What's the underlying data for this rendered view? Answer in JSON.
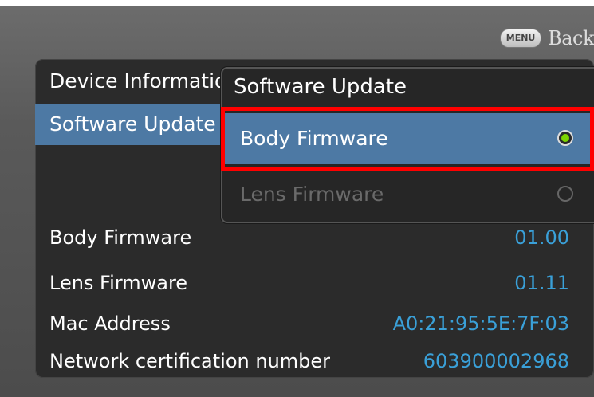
{
  "header": {
    "menu_button_label": "MENU",
    "back_label": "Back"
  },
  "sidebar": {
    "items": [
      {
        "label": "Device Information"
      },
      {
        "label": "Software Update"
      }
    ]
  },
  "popup": {
    "title": "Software Update",
    "options": [
      {
        "label": "Body Firmware",
        "selected": true,
        "enabled": true
      },
      {
        "label": "Lens Firmware",
        "selected": false,
        "enabled": false
      }
    ]
  },
  "info": {
    "rows": [
      {
        "label": "Body Firmware",
        "value": "01.00"
      },
      {
        "label": "Lens Firmware",
        "value": "01.11"
      },
      {
        "label": "Mac Address",
        "value": "A0:21:95:5E:7F:03"
      },
      {
        "label": "Network certification number",
        "value": "603900002968"
      }
    ]
  },
  "colors": {
    "selection_blue": "#4d79a4",
    "value_blue": "#3aa0d8",
    "radio_on": "#7cd400",
    "highlight_red": "#ff0000"
  }
}
